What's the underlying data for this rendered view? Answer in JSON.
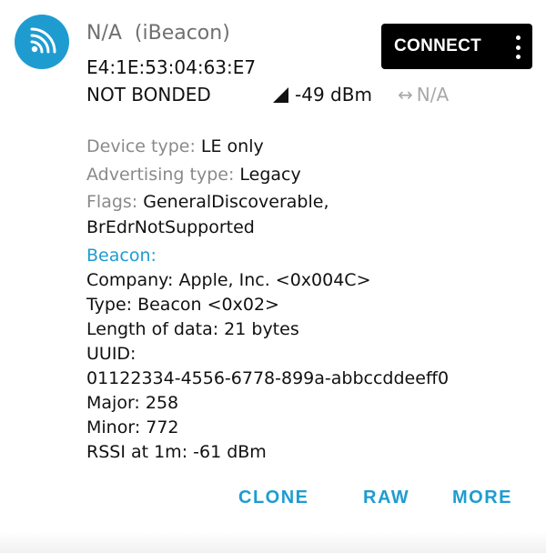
{
  "device": {
    "title": "N/A  (iBeacon)",
    "mac": "E4:1E:53:04:63:E7",
    "bond_state": "NOT BONDED",
    "rssi": "-49 dBm",
    "interval": "N/A",
    "avatar_icon": "broadcast-icon",
    "accent_color": "#1e9cd0"
  },
  "actions": {
    "connect_label": "CONNECT",
    "overflow_icon": "more-vert-icon",
    "clone_label": "CLONE",
    "raw_label": "RAW",
    "more_label": "MORE"
  },
  "details": {
    "device_type_label": "Device type: ",
    "device_type_value": "LE only",
    "adv_type_label": "Advertising type: ",
    "adv_type_value": "Legacy",
    "flags_label": "Flags: ",
    "flags_value": "GeneralDiscoverable, BrEdrNotSupported"
  },
  "beacon": {
    "header": "Beacon:",
    "company": "Company: Apple, Inc. <0x004C>",
    "type": "Type: Beacon <0x02>",
    "length": "Length of data: 21 bytes",
    "uuid_label": "UUID:",
    "uuid_value": "01122334-4556-6778-899a-abbccddeeff0",
    "major": "Major: 258",
    "minor": "Minor: 772",
    "rssi_1m": "RSSI at 1m: -61 dBm"
  }
}
